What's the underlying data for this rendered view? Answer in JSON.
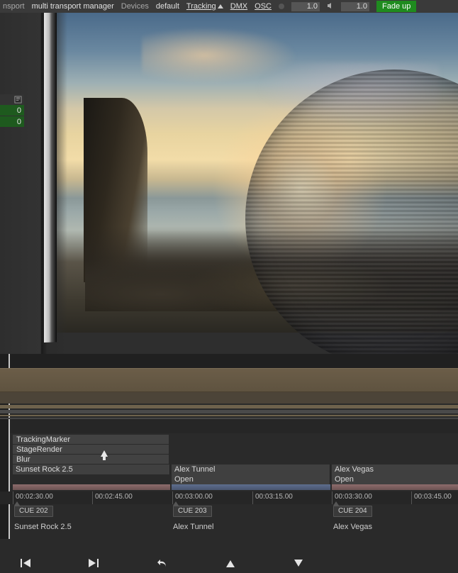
{
  "menubar": {
    "transport": "nsport",
    "title": "multi transport manager",
    "devices": "Devices",
    "default": "default",
    "tracking": "Tracking",
    "dmx": "DMX",
    "osc": "OSC",
    "val1": "1.0",
    "val2": "1.0",
    "fade_up": "Fade up"
  },
  "side": {
    "v1": "0",
    "v2": "0"
  },
  "tracks": {
    "labels": [
      "TrackingMarker",
      "StageRender",
      "Blur",
      "Sunset Rock 2.5"
    ],
    "clips": [
      {
        "name": "Alex Tunnel",
        "open": "Open"
      },
      {
        "name": "Alex Vegas",
        "open": "Open"
      }
    ]
  },
  "ruler": {
    "ticks": [
      "00:02:30.00",
      "00:02:45.00",
      "00:03:00.00",
      "00:03:15.00",
      "00:03:30.00",
      "00:03:45.00"
    ]
  },
  "cues": {
    "items": [
      "CUE 202",
      "CUE 203",
      "CUE 204"
    ],
    "labels": [
      "Sunset Rock 2.5",
      "Alex Tunnel",
      "Alex Vegas"
    ]
  }
}
